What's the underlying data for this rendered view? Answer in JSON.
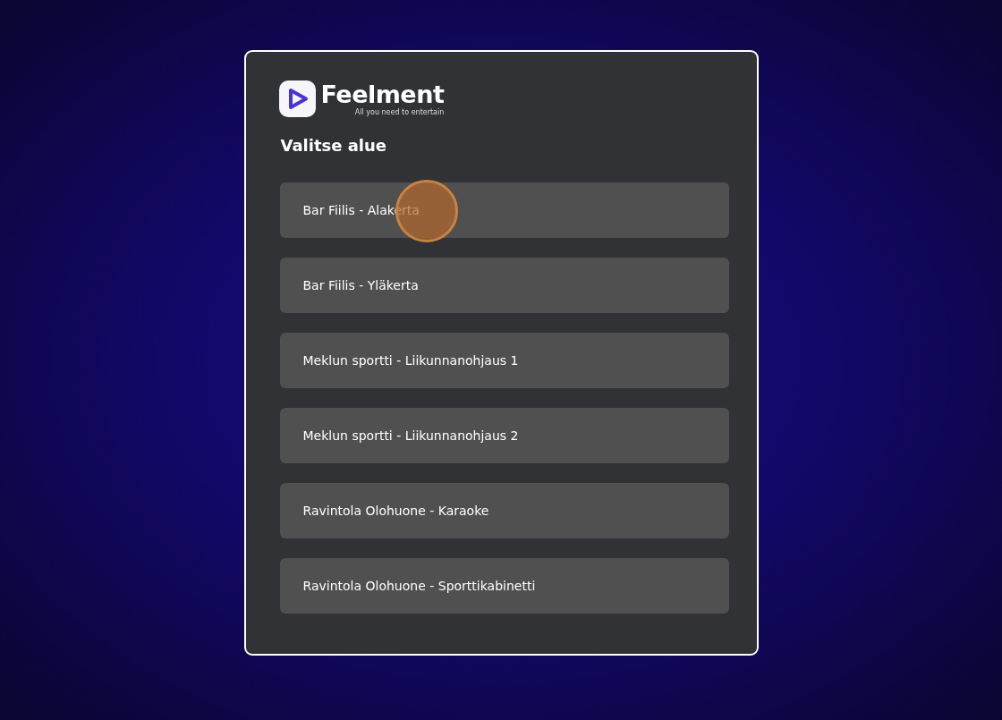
{
  "logo": {
    "name": "Feelment",
    "tagline": "All you need to entertain"
  },
  "heading": "Valitse alue",
  "areas": [
    {
      "label": "Bar Fiilis - Alakerta",
      "clicked": true
    },
    {
      "label": "Bar Fiilis - Yläkerta",
      "clicked": false
    },
    {
      "label": "Meklun sportti - Liikunnanohjaus 1",
      "clicked": false
    },
    {
      "label": "Meklun sportti - Liikunnanohjaus 2",
      "clicked": false
    },
    {
      "label": "Ravintola Olohuone - Karaoke",
      "clicked": false
    },
    {
      "label": "Ravintola Olohuone - Sporttikabinetti",
      "clicked": false
    }
  ]
}
